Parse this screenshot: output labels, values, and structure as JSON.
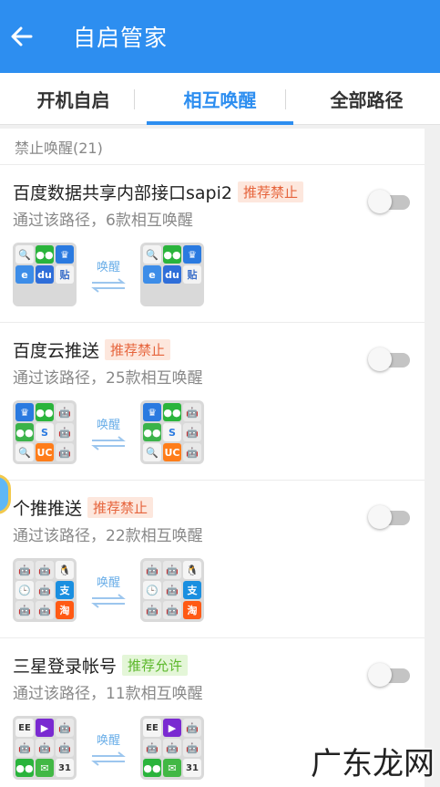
{
  "appbar": {
    "title": "自启管家",
    "back_icon": "arrow-left-icon",
    "bg_color": "#2d8ef0"
  },
  "tabs": [
    {
      "label": "开机自启",
      "active": false
    },
    {
      "label": "相互唤醒",
      "active": true
    },
    {
      "label": "全部路径",
      "active": false
    }
  ],
  "list": {
    "header": "禁止唤醒(21)",
    "arrow_label": "唤醒",
    "items": [
      {
        "name": "百度数据共享内部接口sapi2",
        "badge": "推荐禁止",
        "badge_type": "forbid",
        "desc": "通过该路径，6款相互唤醒",
        "enabled": false
      },
      {
        "name": "百度云推送",
        "badge": "推荐禁止",
        "badge_type": "forbid",
        "desc": "通过该路径，25款相互唤醒",
        "enabled": false
      },
      {
        "name": "个推推送",
        "badge": "推荐禁止",
        "badge_type": "forbid",
        "desc": "通过该路径，22款相互唤醒",
        "enabled": false
      },
      {
        "name": "三星登录帐号",
        "badge": "推荐允许",
        "badge_type": "allow",
        "desc": "通过该路径，11款相互唤醒",
        "enabled": false
      }
    ]
  },
  "watermark": {
    "text": "广东龙网"
  }
}
